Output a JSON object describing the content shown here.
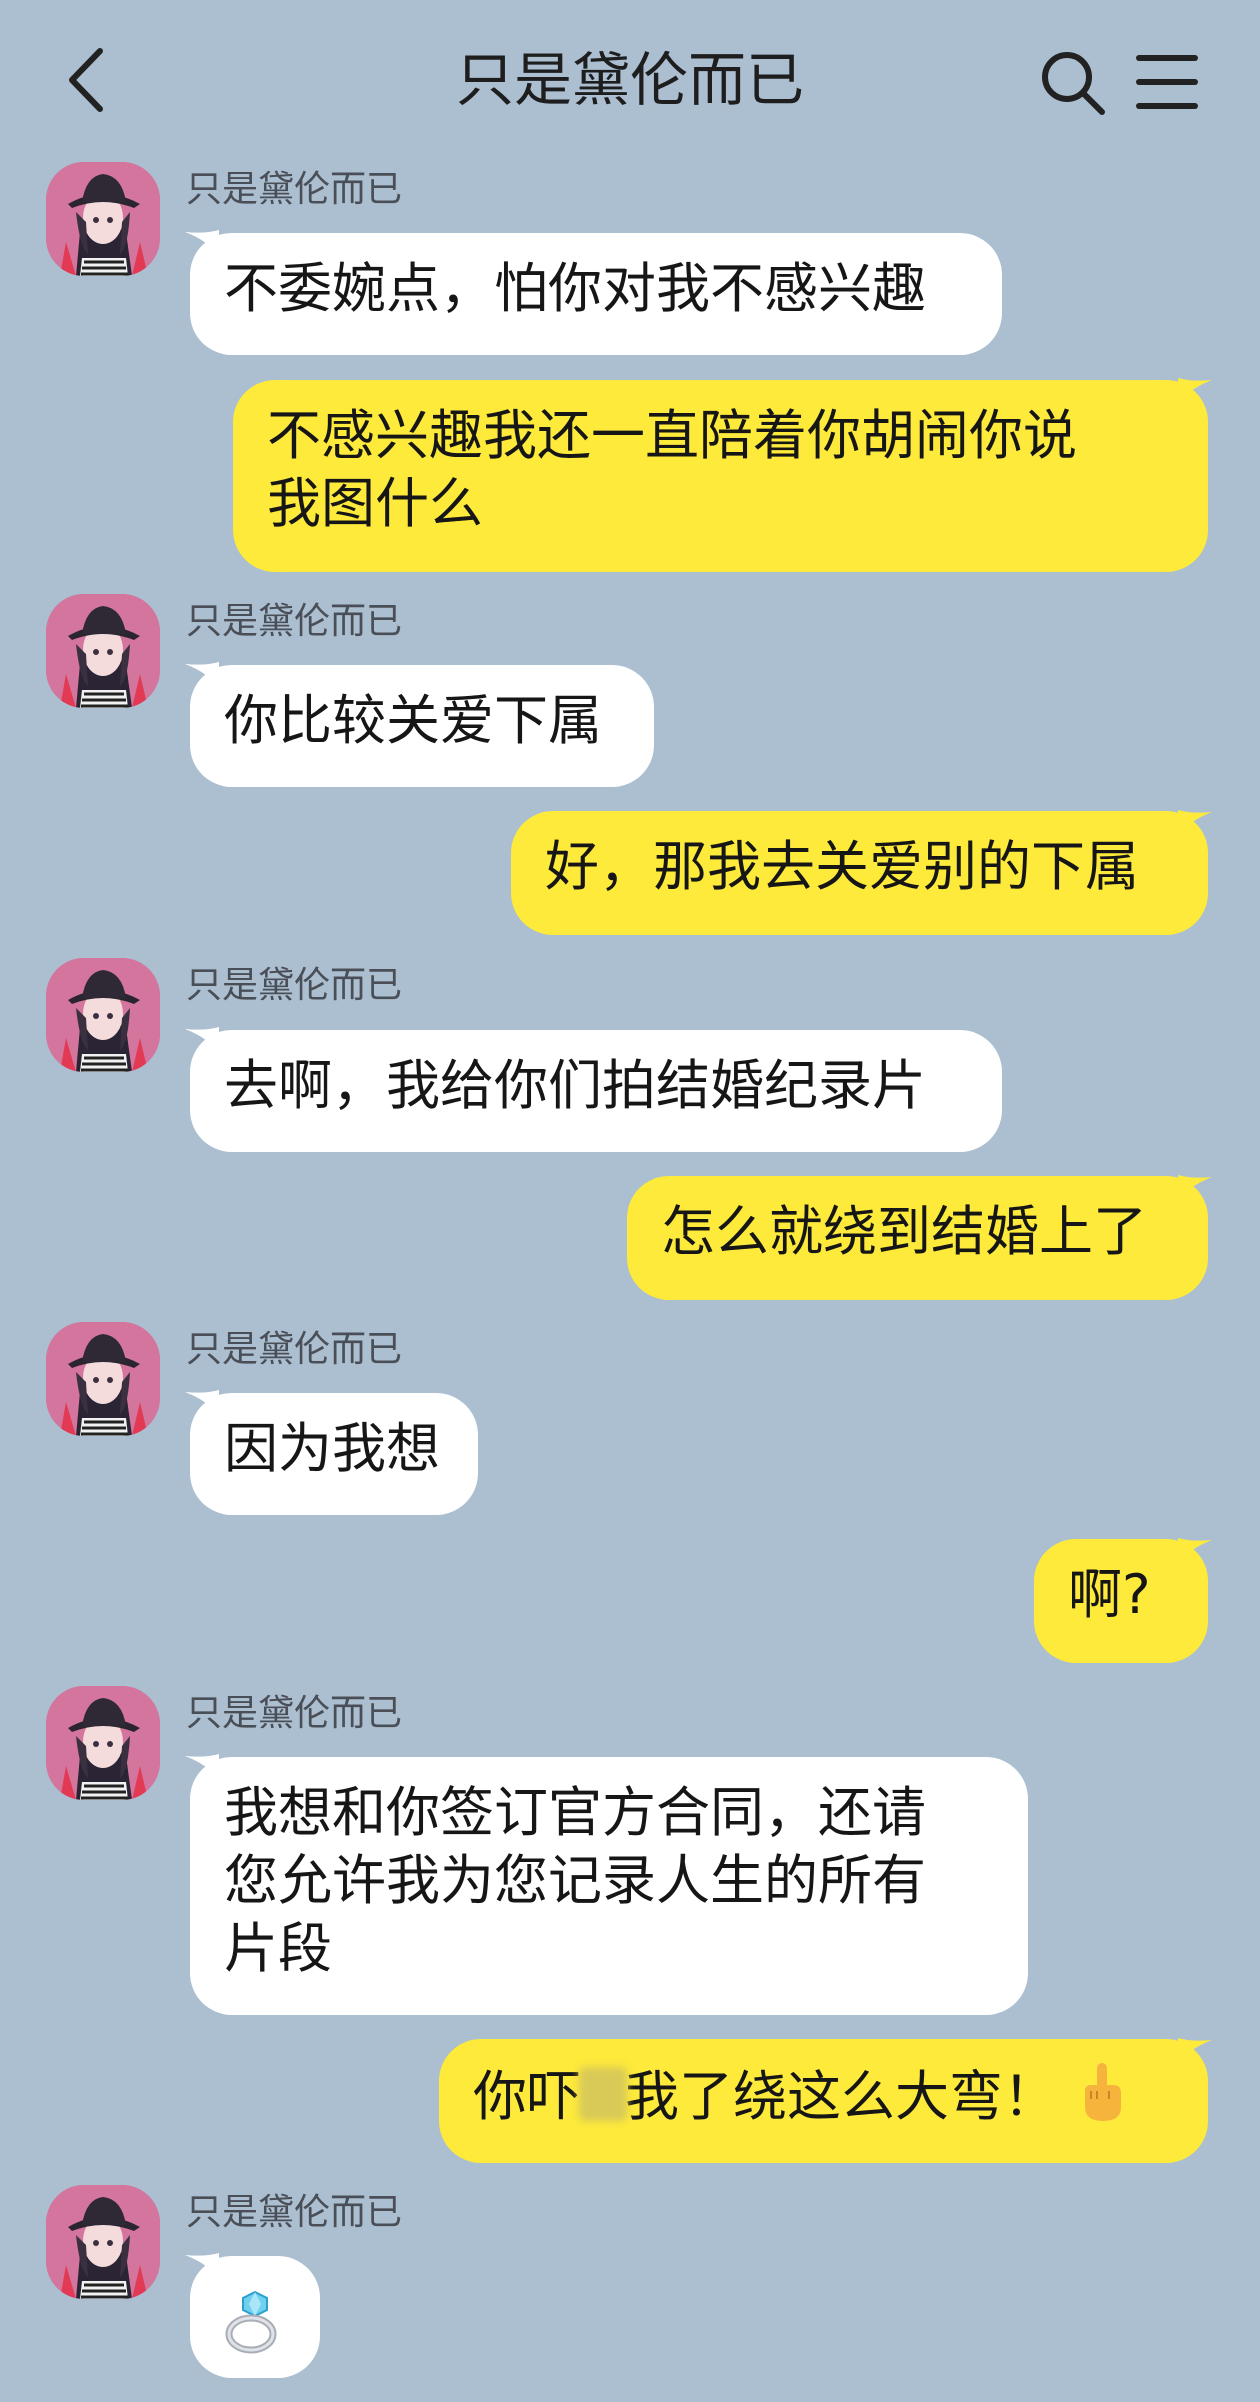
{
  "header": {
    "title": "只是黛伦而已"
  },
  "messages": [
    {
      "side": "in",
      "sender": "只是黛伦而已",
      "text": "不委婉点，怕你对我不感兴趣"
    },
    {
      "side": "out",
      "text": "不感兴趣我还一直陪着你胡闹你说\n我图什么"
    },
    {
      "side": "in",
      "sender": "只是黛伦而已",
      "text": "你比较关爱下属"
    },
    {
      "side": "out",
      "text": "好，那我去关爱别的下属"
    },
    {
      "side": "in",
      "sender": "只是黛伦而已",
      "text": "去啊，我给你们拍结婚纪录片"
    },
    {
      "side": "out",
      "text": "怎么就绕到结婚上了"
    },
    {
      "side": "in",
      "sender": "只是黛伦而已",
      "text": "因为我想"
    },
    {
      "side": "out",
      "text": "啊?"
    },
    {
      "side": "in",
      "sender": "只是黛伦而已",
      "text": "我想和你签订官方合同，还请\n您允许我为您记录人生的所有\n片段"
    },
    {
      "side": "out",
      "text_before": "你吓",
      "text_after": "我了绕这么大弯！",
      "emoji": "middle-finger-emoji"
    },
    {
      "side": "in",
      "sender": "只是黛伦而已",
      "emoji": "ring-emoji"
    }
  ],
  "colors": {
    "background": "#abbfd1",
    "incoming_bubble": "#ffffff",
    "outgoing_bubble": "#fdea3b"
  }
}
